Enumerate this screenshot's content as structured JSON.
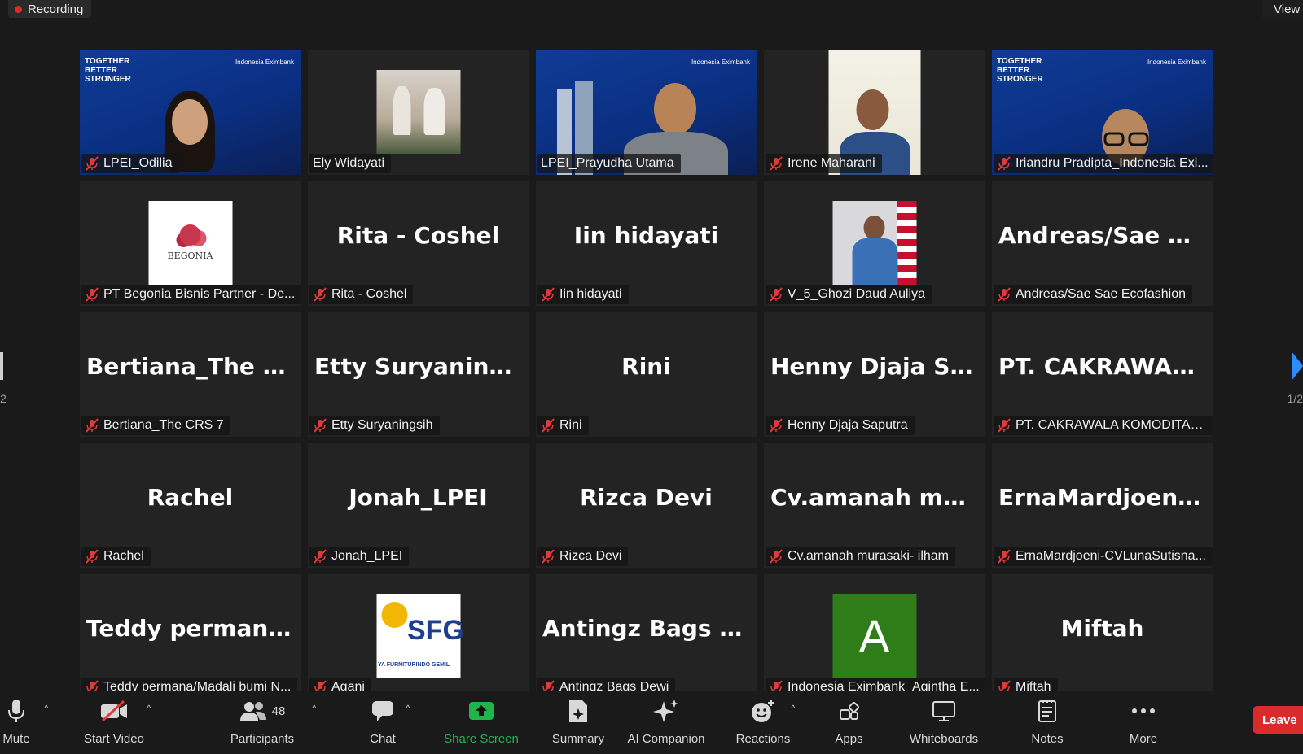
{
  "recording": {
    "label": "Recording"
  },
  "view": {
    "label": "View"
  },
  "pagination": {
    "left": "2",
    "right": "1/2"
  },
  "tiles": [
    {
      "label": "LPEI_Odilia",
      "type": "video",
      "tagline": "TOGETHER BETTER STRONGER",
      "brand": "Indonesia Eximbank",
      "muted": true
    },
    {
      "label": "Ely Widayati",
      "type": "photo",
      "muted": false
    },
    {
      "label": "LPEI_Prayudha Utama",
      "type": "video",
      "brand": "Indonesia Eximbank",
      "muted": false,
      "active": true
    },
    {
      "label": "Irene Maharani",
      "type": "video-small",
      "muted": true
    },
    {
      "label": "Iriandru Pradipta_Indonesia Exi...",
      "type": "video",
      "tagline": "TOGETHER BETTER STRONGER",
      "brand": "Indonesia Eximbank",
      "muted": true
    },
    {
      "label": "PT Begonia Bisnis Partner - De...",
      "type": "logo-begonia",
      "logo_text": "BEGONIA",
      "muted": true
    },
    {
      "label": "Rita - Coshel",
      "big": "Rita - Coshel",
      "muted": true
    },
    {
      "label": "Iin hidayati",
      "big": "Iin hidayati",
      "muted": true
    },
    {
      "label": "V_5_Ghozi Daud Auliya",
      "type": "photo-flag",
      "muted": true
    },
    {
      "label": "Andreas/Sae Sae Ecofashion",
      "big": "Andreas/Sae Sa...",
      "muted": true
    },
    {
      "label": "Bertiana_The CRS 7",
      "big": "Bertiana_The C...",
      "muted": true
    },
    {
      "label": "Etty Suryaningsih",
      "big": "Etty Suryaningsih",
      "muted": true
    },
    {
      "label": "Rini",
      "big": "Rini",
      "muted": true
    },
    {
      "label": "Henny Djaja Saputra",
      "big": "Henny Djaja Sa...",
      "muted": true
    },
    {
      "label": "PT. CAKRAWALA KOMODITAS I...",
      "big": "PT. CAKRAWAL...",
      "muted": true
    },
    {
      "label": "Rachel",
      "big": "Rachel",
      "muted": true
    },
    {
      "label": "Jonah_LPEI",
      "big": "Jonah_LPEI",
      "muted": true
    },
    {
      "label": "Rizca Devi",
      "big": "Rizca Devi",
      "muted": true
    },
    {
      "label": "Cv.amanah murasaki- ilham",
      "big": "Cv.amanah mur...",
      "muted": true
    },
    {
      "label": "ErnaMardjoeni-CVLunaSutisna...",
      "big": "ErnaMardjoeni-...",
      "muted": true
    },
    {
      "label": "Teddy permana/Madali bumi N...",
      "big": "Teddy permana...",
      "muted": true
    },
    {
      "label": "Agani",
      "type": "logo-sfg",
      "logo_text": "SFG",
      "logo_sub": "YA FURNITURINDO GEMIL",
      "muted": true
    },
    {
      "label": "Antingz Bags Dewi",
      "big": "Antingz Bags D...",
      "muted": true
    },
    {
      "label": "Indonesia Eximbank_Agintha E...",
      "type": "avatar-letter",
      "letter": "A",
      "muted": true
    },
    {
      "label": "Miftah",
      "big": "Miftah",
      "muted": true
    }
  ],
  "toolbar": {
    "mute": "Mute",
    "start_video": "Start Video",
    "participants": "Participants",
    "participants_count": "48",
    "chat": "Chat",
    "share_screen": "Share Screen",
    "summary": "Summary",
    "ai_companion": "AI Companion",
    "reactions": "Reactions",
    "apps": "Apps",
    "whiteboards": "Whiteboards",
    "notes": "Notes",
    "more": "More",
    "leave": "Leave"
  },
  "colors": {
    "active_border": "#e9f56a",
    "share_green": "#1fb54a",
    "leave_red": "#d92b2b",
    "recording_dot": "#e02828",
    "mute_red": "#e03a3a"
  }
}
